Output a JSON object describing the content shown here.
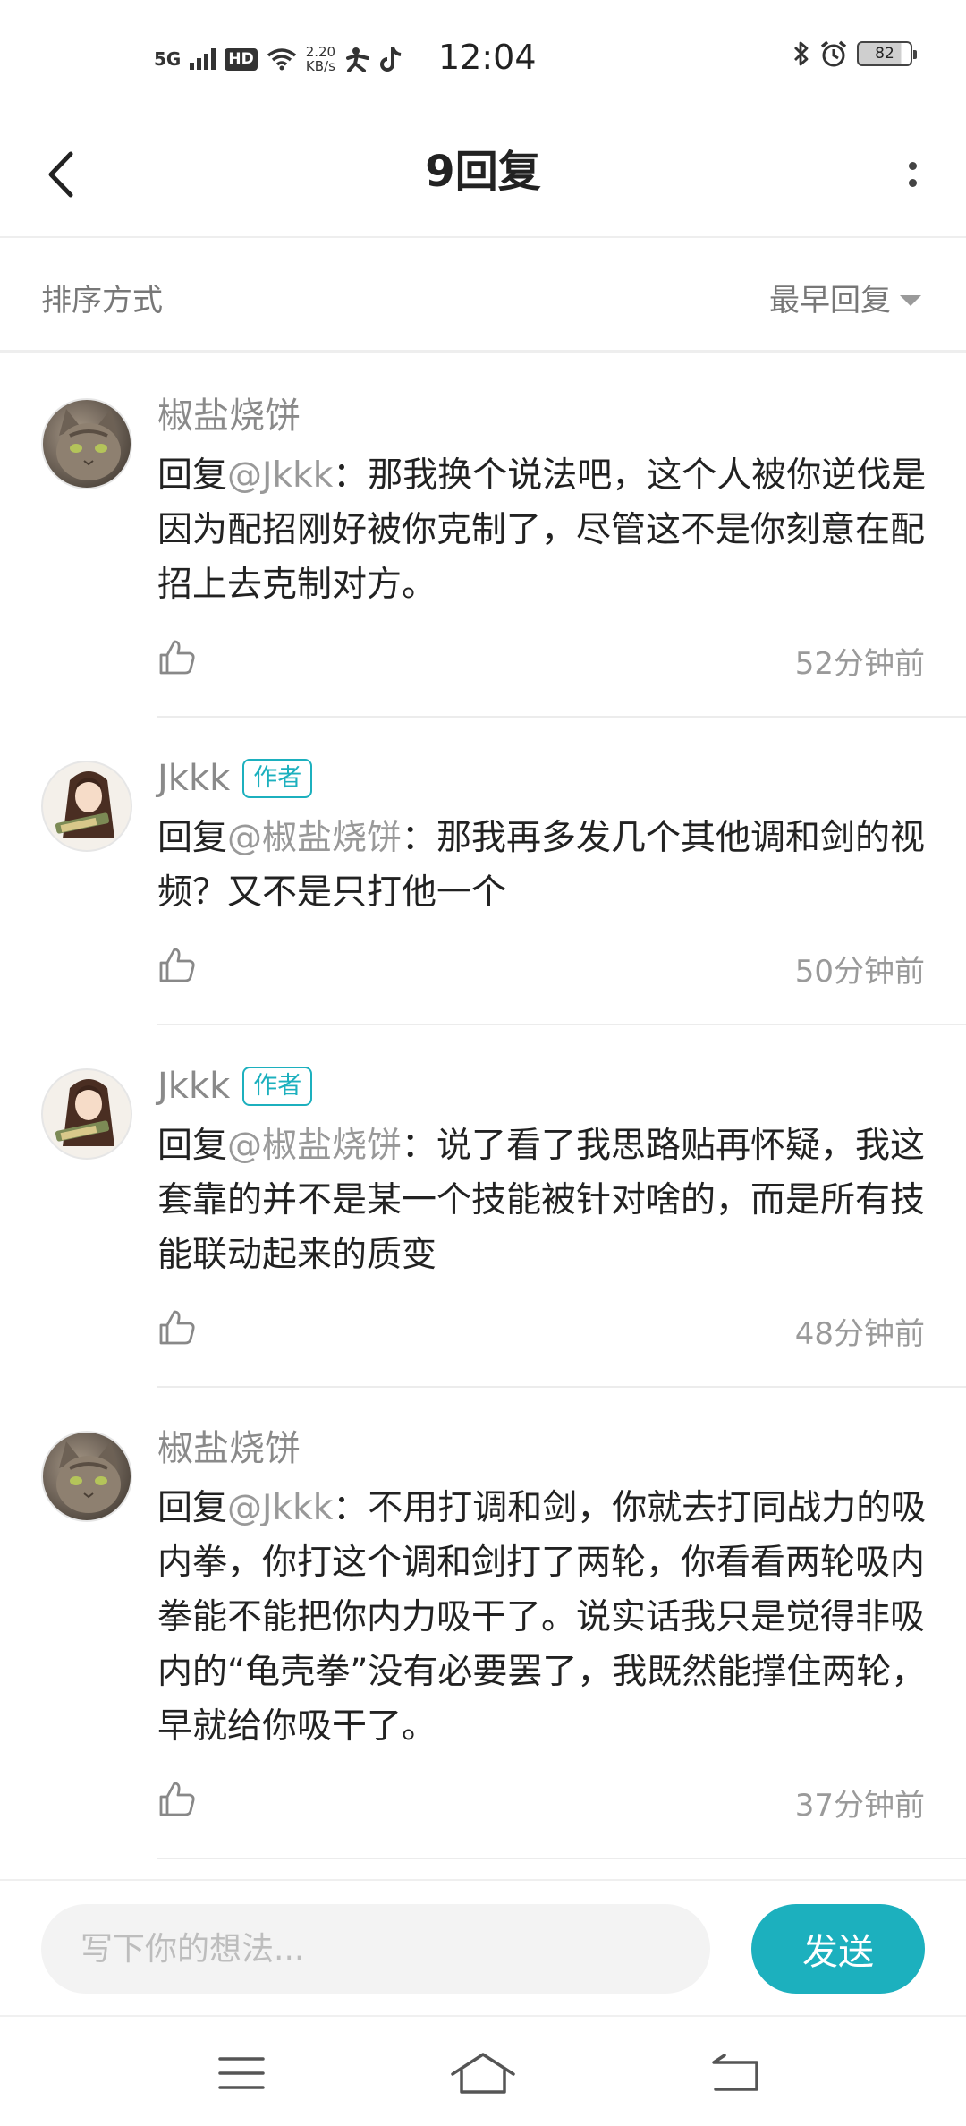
{
  "status_bar": {
    "network": "5G",
    "hd": "HD",
    "speed_value": "2.20",
    "speed_unit": "KB/s",
    "time": "12:04",
    "battery": "82"
  },
  "header": {
    "title": "9回复"
  },
  "sort": {
    "label": "排序方式",
    "selected": "最早回复"
  },
  "comments": [
    {
      "name": "椒盐烧饼",
      "is_author": false,
      "reply_prefix": "回复",
      "mention": "@Jkkk",
      "text": "：那我换个说法吧，这个人被你逆伐是因为配招刚好被你克制了，尽管这不是你刻意在配招上去克制对方。",
      "time": "52分钟前"
    },
    {
      "name": "Jkkk",
      "is_author": true,
      "badge": "作者",
      "reply_prefix": "回复",
      "mention": "@椒盐烧饼",
      "text": "：那我再多发几个其他调和剑的视频？又不是只打他一个",
      "time": "50分钟前"
    },
    {
      "name": "Jkkk",
      "is_author": true,
      "badge": "作者",
      "reply_prefix": "回复",
      "mention": "@椒盐烧饼",
      "text": "：说了看了我思路贴再怀疑，我这套靠的并不是某一个技能被针对啥的，而是所有技能联动起来的质变",
      "time": "48分钟前"
    },
    {
      "name": "椒盐烧饼",
      "is_author": false,
      "reply_prefix": "回复",
      "mention": "@Jkkk",
      "text": "：不用打调和剑，你就去打同战力的吸内拳，你打这个调和剑打了两轮，你看看两轮吸内拳能不能把你内力吸干了。说实话我只是觉得非吸内的“龟壳拳”没有必要罢了，我既然能撑住两轮，早就给你吸干了。",
      "time": "37分钟前"
    }
  ],
  "input": {
    "placeholder": "写下你的想法...",
    "send_label": "发送"
  },
  "colors": {
    "accent": "#1cb0be",
    "mention": "#999999"
  }
}
